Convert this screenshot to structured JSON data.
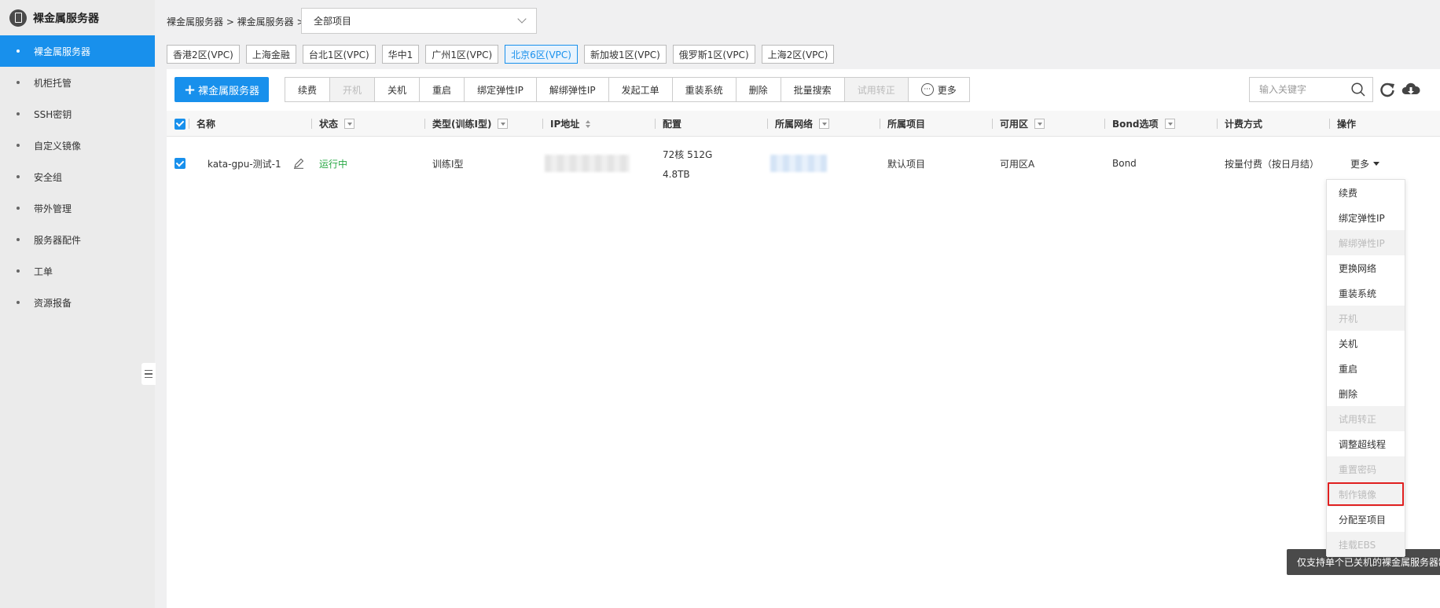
{
  "sidebar": {
    "title": "裸金属服务器",
    "items": [
      {
        "label": "裸金属服务器",
        "active": true
      },
      {
        "label": "机柜托管"
      },
      {
        "label": "SSH密钥"
      },
      {
        "label": "自定义镜像"
      },
      {
        "label": "安全组"
      },
      {
        "label": "带外管理"
      },
      {
        "label": "服务器配件"
      },
      {
        "label": "工单"
      },
      {
        "label": "资源报备"
      }
    ]
  },
  "breadcrumb": "裸金属服务器 > 裸金属服务器 >",
  "project_select": {
    "value": "全部项目"
  },
  "regions": [
    "香港2区(VPC)",
    "上海金融",
    "台北1区(VPC)",
    "华中1",
    "广州1区(VPC)",
    "北京6区(VPC)",
    "新加坡1区(VPC)",
    "俄罗斯1区(VPC)",
    "上海2区(VPC)"
  ],
  "active_region": "北京6区(VPC)",
  "toolbar": {
    "add_label": "裸金属服务器",
    "actions": [
      {
        "label": "续费",
        "disabled": false
      },
      {
        "label": "开机",
        "disabled": true
      },
      {
        "label": "关机",
        "disabled": false
      },
      {
        "label": "重启",
        "disabled": false
      },
      {
        "label": "绑定弹性IP",
        "disabled": false
      },
      {
        "label": "解绑弹性IP",
        "disabled": false
      },
      {
        "label": "发起工单",
        "disabled": false
      },
      {
        "label": "重装系统",
        "disabled": false
      },
      {
        "label": "删除",
        "disabled": false
      },
      {
        "label": "批量搜索",
        "disabled": false
      },
      {
        "label": "试用转正",
        "disabled": true
      }
    ],
    "more_label": "更多",
    "search_placeholder": "输入关键字"
  },
  "table": {
    "columns": {
      "name": "名称",
      "status": "状态",
      "type": "类型(训练I型)",
      "ip": "IP地址",
      "config": "配置",
      "network": "所属网络",
      "project": "所属项目",
      "zone": "可用区",
      "bond": "Bond选项",
      "billing": "计费方式",
      "actions": "操作"
    },
    "rows": [
      {
        "name": "kata-gpu-测试-1",
        "status": "运行中",
        "type": "训练I型",
        "config_cpu_mem": "72核 512G",
        "config_disk": "4.8TB",
        "project": "默认项目",
        "zone": "可用区A",
        "bond": "Bond",
        "billing": "按量付费（按日月结）",
        "more_label": "更多"
      }
    ]
  },
  "dropdown": {
    "items": [
      {
        "label": "续费",
        "disabled": false
      },
      {
        "label": "绑定弹性IP",
        "disabled": false
      },
      {
        "label": "解绑弹性IP",
        "disabled": true
      },
      {
        "label": "更换网络",
        "disabled": false
      },
      {
        "label": "重装系统",
        "disabled": false
      },
      {
        "label": "开机",
        "disabled": true
      },
      {
        "label": "关机",
        "disabled": false
      },
      {
        "label": "重启",
        "disabled": false
      },
      {
        "label": "删除",
        "disabled": false
      },
      {
        "label": "试用转正",
        "disabled": true
      },
      {
        "label": "调整超线程",
        "disabled": false
      },
      {
        "label": "重置密码",
        "disabled": true
      },
      {
        "label": "制作镜像",
        "disabled": true,
        "highlighted": true
      },
      {
        "label": "分配至项目",
        "disabled": false
      },
      {
        "label": "挂载EBS",
        "disabled": true
      }
    ]
  },
  "tooltip": "仅支持单个已关机的裸金属服务器制作镜像",
  "colors": {
    "accent": "#1890ec",
    "running": "#27a844",
    "highlight_border": "#e02020"
  }
}
